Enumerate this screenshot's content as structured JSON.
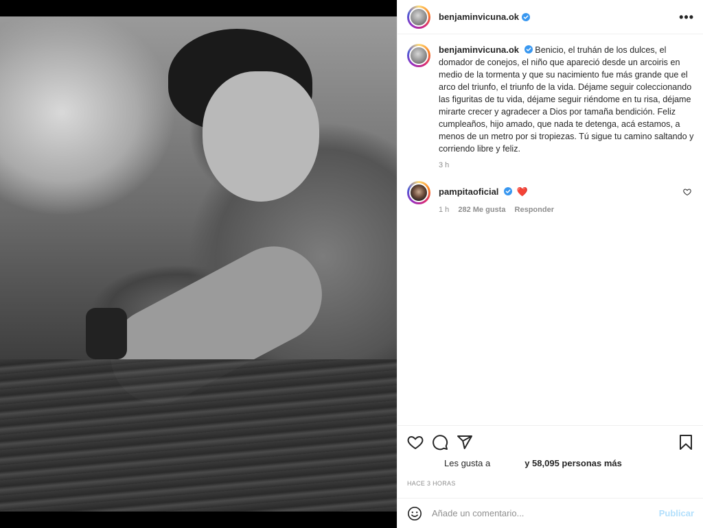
{
  "post": {
    "author": "benjaminvicuna.ok",
    "photo_alt": "Foto en blanco y negro de un niño sonriendo abrazado a un hombre en el agua"
  },
  "caption": {
    "author": "benjaminvicuna.ok",
    "text": "Benicio, el truhán de los dulces, el domador de conejos, el niño que apareció desde un arcoiris en medio de la tormenta y que su nacimiento fue más grande que el arco del triunfo, el triunfo de la vida. Déjame seguir coleccionando las figuritas de tu vida, déjame seguir riéndome en tu risa, déjame mirarte crecer y agradecer a Dios por tamaña bendición. Feliz cumpleaños, hijo amado, que nada te detenga, acá estamos, a menos de un metro por si tropiezas. Tú sigue tu camino saltando y corriendo libre y feliz.",
    "time": "3 h"
  },
  "comments": [
    {
      "author": "pampitaoficial",
      "text": "❤️",
      "time": "1 h",
      "likes": "282 Me gusta",
      "reply_label": "Responder"
    }
  ],
  "likes": {
    "prefix": "Les gusta a",
    "suffix": "y 58,095 personas más"
  },
  "timestamp": "HACE 3 HORAS",
  "add_comment": {
    "placeholder": "Añade un comentario...",
    "publish_label": "Publicar"
  },
  "colors": {
    "verified": "#3897f0",
    "heart_red": "#ed4956",
    "publish_disabled": "#b2dffc",
    "muted_text": "#8e8e8e"
  },
  "icons": [
    "more-icon",
    "verified-icon",
    "heart-icon",
    "comment-icon",
    "share-icon",
    "bookmark-icon",
    "emoji-icon"
  ]
}
